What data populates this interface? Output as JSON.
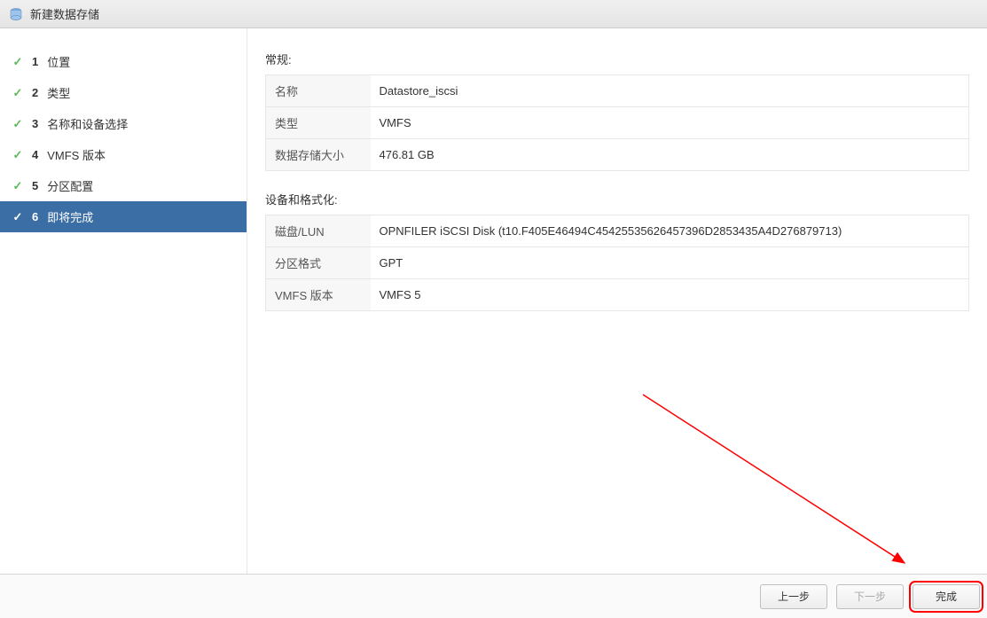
{
  "titlebar": {
    "title": "新建数据存储"
  },
  "wizard": {
    "steps": [
      {
        "num": "1",
        "label": "位置",
        "done": true
      },
      {
        "num": "2",
        "label": "类型",
        "done": true
      },
      {
        "num": "3",
        "label": "名称和设备选择",
        "done": true
      },
      {
        "num": "4",
        "label": "VMFS 版本",
        "done": true
      },
      {
        "num": "5",
        "label": "分区配置",
        "done": true
      },
      {
        "num": "6",
        "label": "即将完成",
        "done": true,
        "active": true
      }
    ]
  },
  "sections": {
    "general": {
      "title": "常规:",
      "rows": {
        "name_label": "名称",
        "name_value": "Datastore_iscsi",
        "type_label": "类型",
        "type_value": "VMFS",
        "size_label": "数据存储大小",
        "size_value": "476.81 GB"
      }
    },
    "device": {
      "title": "设备和格式化:",
      "rows": {
        "disk_label": "磁盘/LUN",
        "disk_value": "OPNFILER iSCSI Disk (t10.F405E46494C45425535626457396D2853435A4D276879713)",
        "part_label": "分区格式",
        "part_value": "GPT",
        "vmfs_label": "VMFS 版本",
        "vmfs_value": "VMFS 5"
      }
    }
  },
  "footer": {
    "back": "上一步",
    "next": "下一步",
    "finish": "完成"
  }
}
